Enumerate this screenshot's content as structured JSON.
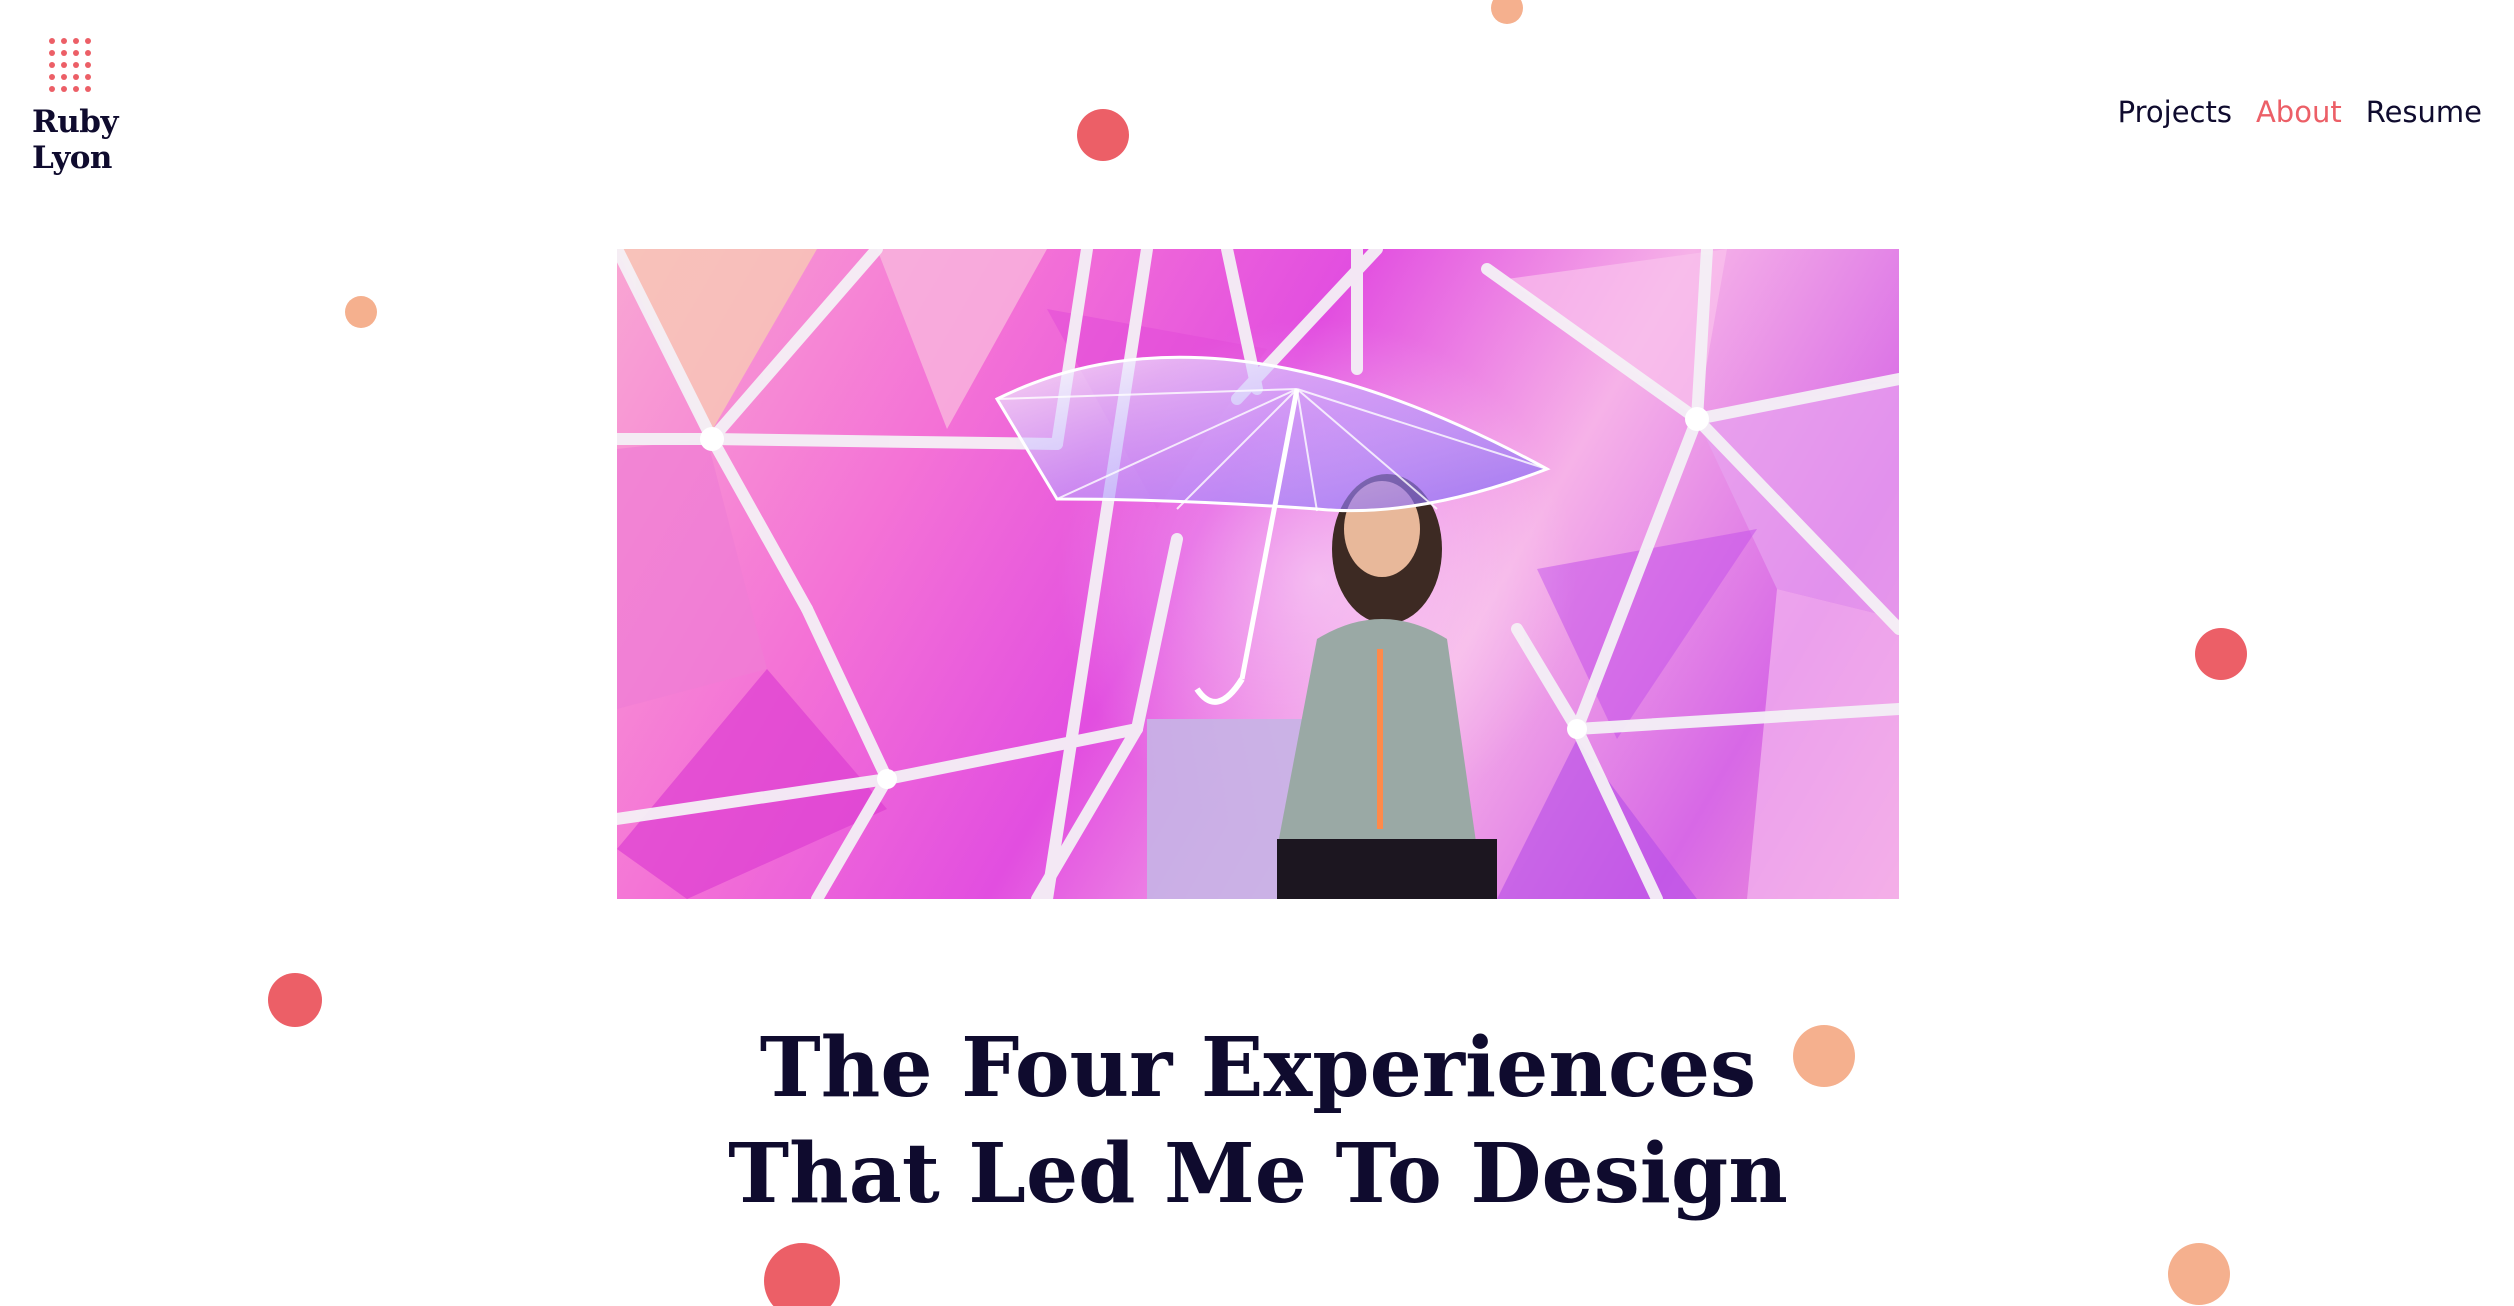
{
  "logo": {
    "line1": "Ruby",
    "line2": "Lyon",
    "icon": "dotted-r-monogram-icon",
    "accent_color": "#ec5f67"
  },
  "nav": {
    "items": [
      {
        "label": "Projects",
        "active": false
      },
      {
        "label": "About",
        "active": true
      },
      {
        "label": "Resume",
        "active": false
      }
    ],
    "active_color": "#ec5f67",
    "text_color": "#0f0b2e"
  },
  "hero": {
    "image": "woman-with-clear-umbrella-in-iridescent-geodesic-dome-photo"
  },
  "article": {
    "title_line1": "The Four Experiences",
    "title_line2": "That Led Me To Design"
  },
  "decorations": {
    "dot_colors": {
      "coral": "#ec5f67",
      "peach": "#f5b08e"
    }
  }
}
